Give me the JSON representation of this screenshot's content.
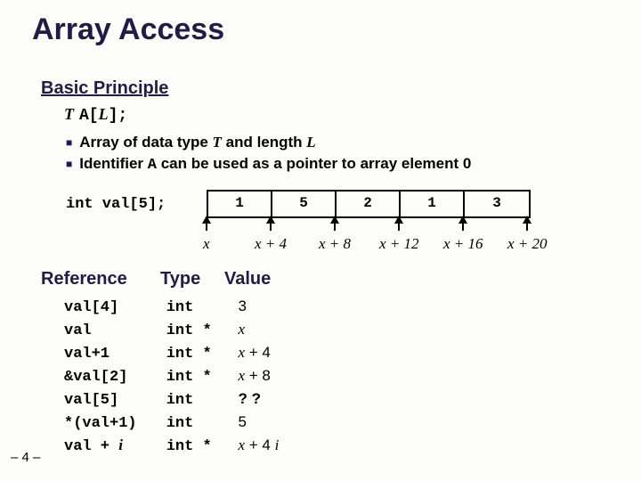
{
  "title": "Array Access",
  "section_basic": "Basic Principle",
  "decl": {
    "T": "T",
    "A": "A[",
    "L": "L",
    "close": "];"
  },
  "bullets": {
    "b1_pre": "Array of data type ",
    "b1_T": "T",
    "b1_mid": " and length ",
    "b1_L": "L",
    "b2_pre": "Identifier ",
    "b2_A": "A",
    "b2_post": " can be used as a pointer to array element 0"
  },
  "code": "int val[5];",
  "cells": [
    "1",
    "5",
    "2",
    "1",
    "3"
  ],
  "xlabels": [
    "x",
    "x + 4",
    "x + 8",
    "x + 12",
    "x + 16",
    "x + 20"
  ],
  "section_ref": "Reference",
  "col_type": "Type",
  "col_value": "Value",
  "rows": [
    {
      "ref": "val[4]",
      "type": "int",
      "value_plain": "3"
    },
    {
      "ref": "val",
      "type": "int *",
      "value_it": "x"
    },
    {
      "ref": "val+1",
      "type": "int *",
      "value_it": "x",
      "suffix": " + 4"
    },
    {
      "ref": "&val[2]",
      "type": "int *",
      "value_it": "x",
      "suffix": " + 8"
    },
    {
      "ref": "val[5]",
      "type": "int",
      "value_qq": "? ?"
    },
    {
      "ref": "*(val+1)",
      "type": "int",
      "value_plain": "5"
    },
    {
      "ref": "val + ",
      "ref_it": "i",
      "type": "int *",
      "value_it": "x",
      "suffix": " + 4 ",
      "suffix_it": "i"
    }
  ],
  "pagenum": "– 4 –"
}
